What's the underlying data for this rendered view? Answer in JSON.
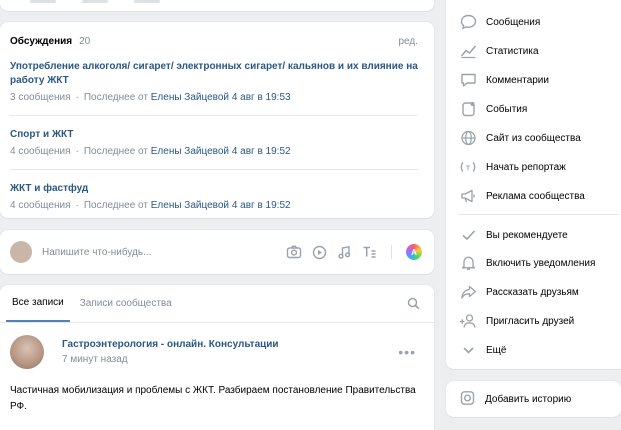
{
  "discussions": {
    "title": "Обсуждения",
    "count": "20",
    "edit": "ред.",
    "topics": [
      {
        "title": "Употребление алкоголя/ сигарет/ электронных сигарет/ кальянов и их влияние на работу ЖКТ",
        "messages": "3 сообщения",
        "last_prefix": "Последнее от",
        "author": "Елены Зайцевой",
        "time": "4 авг в 19:53"
      },
      {
        "title": "Спорт и ЖКТ",
        "messages": "4 сообщения",
        "last_prefix": "Последнее от",
        "author": "Елены Зайцевой",
        "time": "4 авг в 19:52"
      },
      {
        "title": "ЖКТ и фастфуд",
        "messages": "4 сообщения",
        "last_prefix": "Последнее от",
        "author": "Елены Зайцевой",
        "time": "4 авг в 19:52"
      }
    ],
    "dot": "·"
  },
  "composer": {
    "placeholder": "Напишите что-нибудь...",
    "icons": [
      "camera-icon",
      "video-icon",
      "music-icon",
      "article-icon"
    ],
    "aa_label": "A"
  },
  "feed": {
    "tabs": [
      "Все записи",
      "Записи сообщества"
    ],
    "active_tab": 0,
    "post": {
      "author": "Гастроэнтерология - онлайн. Консультации",
      "time": "7 минут назад",
      "more": "•••",
      "text": "Частичная мобилизация и проблемы с ЖКТ. Разбираем постановление Правительства РФ."
    }
  },
  "sidebar": {
    "items": [
      {
        "label": "Сообщения",
        "icon": "message-icon"
      },
      {
        "label": "Статистика",
        "icon": "stats-icon"
      },
      {
        "label": "Комментарии",
        "icon": "comment-icon"
      },
      {
        "label": "События",
        "icon": "event-icon"
      },
      {
        "label": "Сайт из сообщества",
        "icon": "globe-icon"
      },
      {
        "label": "Начать репортаж",
        "icon": "broadcast-icon"
      },
      {
        "label": "Реклама сообщества",
        "icon": "ads-icon"
      },
      {
        "label": "Вы рекомендуете",
        "icon": "check-icon"
      },
      {
        "label": "Включить уведомления",
        "icon": "bell-icon"
      },
      {
        "label": "Рассказать друзьям",
        "icon": "share-icon"
      },
      {
        "label": "Пригласить друзей",
        "icon": "invite-icon"
      },
      {
        "label": "Ещё",
        "icon": "chevron-down-icon"
      }
    ],
    "story_label": "Добавить историю"
  },
  "colors": {
    "link": "#2a5885",
    "secondary": "#818c99",
    "icon": "#99a2ad",
    "accent": "#5181b8",
    "background": "#edeef0"
  }
}
